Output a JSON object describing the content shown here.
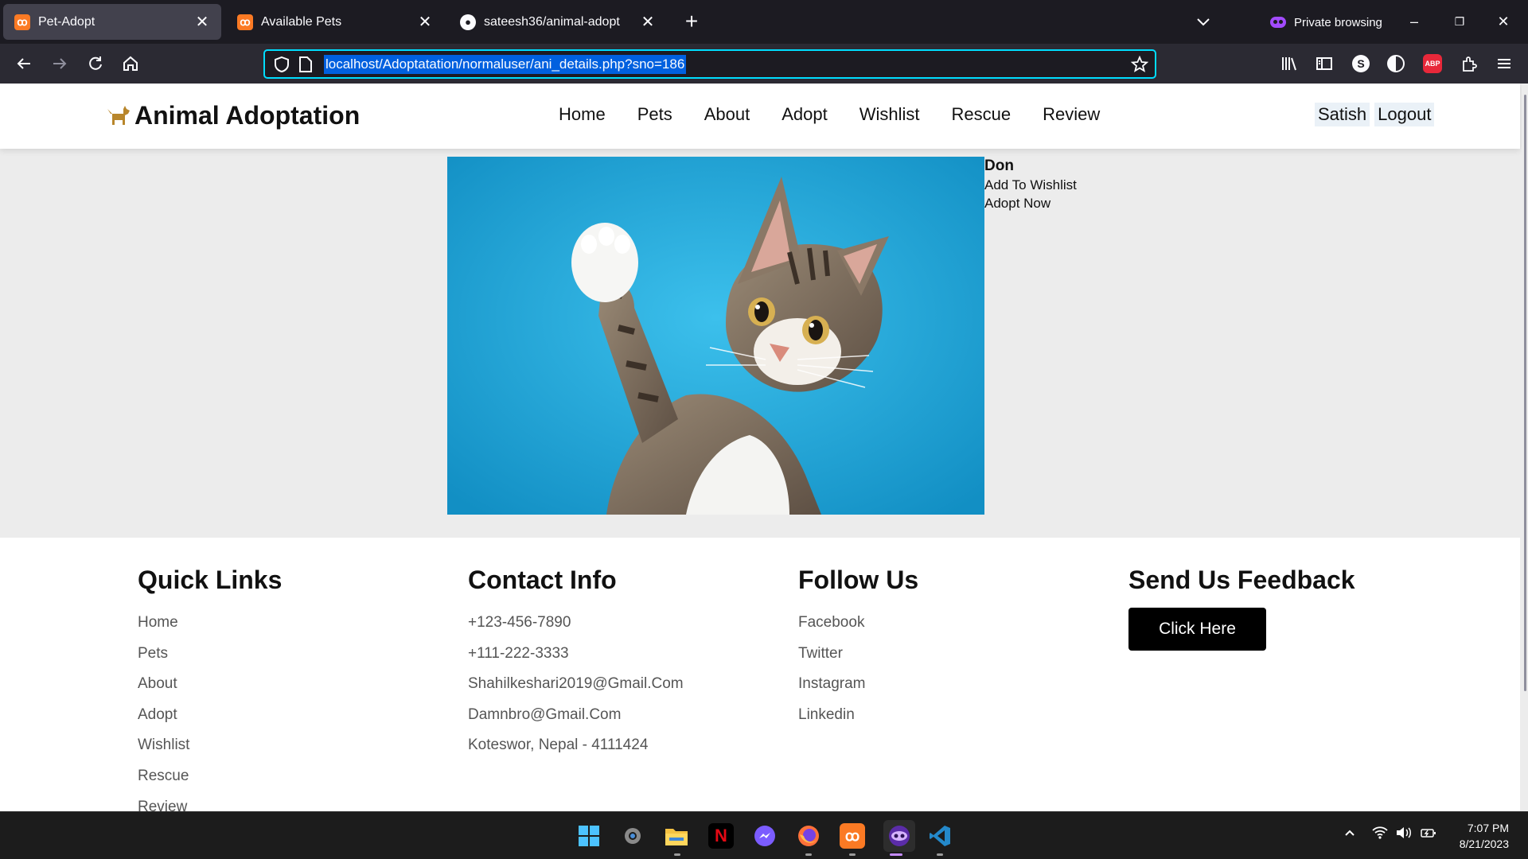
{
  "browser": {
    "tabs": [
      {
        "label": "Pet-Adopt",
        "icon": "xampp-icon",
        "active": true
      },
      {
        "label": "Available Pets",
        "icon": "xampp-icon",
        "active": false
      },
      {
        "label": "sateesh36/animal-adopt",
        "icon": "github-icon",
        "active": false
      }
    ],
    "private_label": "Private browsing",
    "url": "localhost/Adoptatation/normaluser/ani_details.php?sno=186"
  },
  "site": {
    "brand": "Animal Adoptation",
    "menu": [
      "Home",
      "Pets",
      "About",
      "Adopt",
      "Wishlist",
      "Rescue",
      "Review"
    ],
    "user": "Satish",
    "logout": "Logout"
  },
  "pet": {
    "name": "Don",
    "actions": [
      "Add To Wishlist",
      "Adopt Now"
    ]
  },
  "footer": {
    "quick_links": {
      "title": "Quick Links",
      "items": [
        "Home",
        "Pets",
        "About",
        "Adopt",
        "Wishlist",
        "Rescue",
        "Review"
      ]
    },
    "contact": {
      "title": "Contact Info",
      "items": [
        "+123-456-7890",
        "+111-222-3333",
        "Shahilkeshari2019@Gmail.Com",
        "Damnbro@Gmail.Com",
        "Koteswor, Nepal - 4111424"
      ]
    },
    "follow": {
      "title": "Follow Us",
      "items": [
        "Facebook",
        "Twitter",
        "Instagram",
        "Linkedin"
      ]
    },
    "feedback": {
      "title": "Send Us Feedback",
      "button": "Click Here"
    }
  },
  "taskbar": {
    "apps": [
      "windows-start-icon",
      "settings-icon",
      "file-explorer-icon",
      "netflix-icon",
      "messenger-icon",
      "firefox-icon",
      "xampp-icon",
      "firefox-private-icon",
      "vscode-icon"
    ],
    "time": "7:07 PM",
    "date": "8/21/2023"
  },
  "colors": {
    "browser_bg": "#1c1b22",
    "url_focus": "#00ddff",
    "page_bg": "#ececec",
    "brand_icon": "#b8862b",
    "photo_bg": "#1fa7dc"
  }
}
